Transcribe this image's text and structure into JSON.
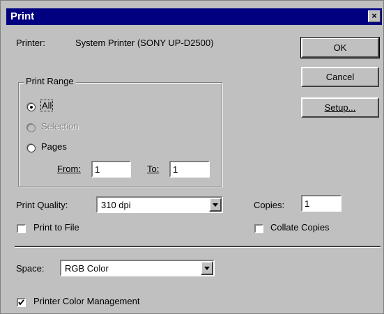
{
  "dialog": {
    "title": "Print",
    "close_glyph": "×"
  },
  "printer": {
    "label": "Printer:",
    "name": "System Printer (SONY UP-D2500)"
  },
  "buttons": {
    "ok": "OK",
    "cancel": "Cancel",
    "setup": "Setup..."
  },
  "print_range": {
    "title": "Print Range",
    "options": [
      {
        "label": "All",
        "checked": true,
        "disabled": false
      },
      {
        "label": "Selection",
        "checked": false,
        "disabled": true
      },
      {
        "label": "Pages",
        "checked": false,
        "disabled": false
      }
    ],
    "from_label": "From:",
    "from_value": "1",
    "to_label": "To:",
    "to_value": "1"
  },
  "print_quality": {
    "label": "Print Quality:",
    "value": "310 dpi"
  },
  "copies": {
    "label": "Copies:",
    "value": "1"
  },
  "print_to_file": {
    "label": "Print to File",
    "checked": false
  },
  "collate": {
    "label": "Collate Copies",
    "checked": false
  },
  "space": {
    "label": "Space:",
    "value": "RGB Color"
  },
  "color_management": {
    "label": "Printer Color Management",
    "checked": true
  },
  "colors": {
    "title_bar": "#000080",
    "face": "#c0c0c0"
  }
}
